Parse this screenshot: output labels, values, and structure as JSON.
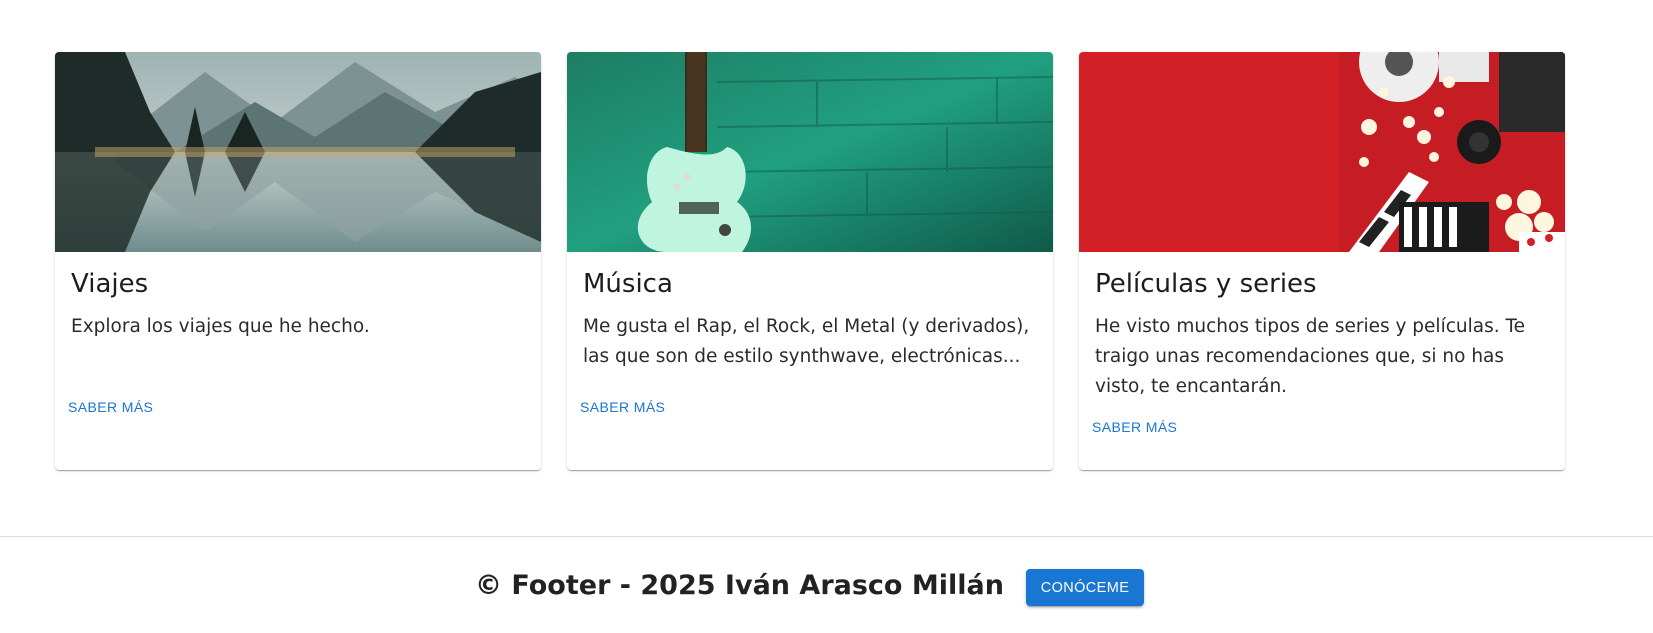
{
  "cards": [
    {
      "title": "Viajes",
      "text": "Explora los viajes que he hecho.",
      "action": "Saber más",
      "image": "mountain-lake-image"
    },
    {
      "title": "Música",
      "text": "Me gusta el Rap, el Rock, el Metal (y derivados), las que son de estilo synthwave, electrónicas...",
      "action": "Saber más",
      "image": "guitar-image"
    },
    {
      "title": "Películas y series",
      "text": "He visto muchos tipos de series y películas. Te traigo unas recomendaciones que, si no has visto, te encantarán.",
      "action": "Saber más",
      "image": "movies-popcorn-image"
    }
  ],
  "footer": {
    "text": "© Footer - 2025 Iván Arasco Millán",
    "button": "Conóceme"
  },
  "colors": {
    "primary": "#1976d2",
    "card_red": "#d32027",
    "card_green": "#1f8a6e"
  }
}
